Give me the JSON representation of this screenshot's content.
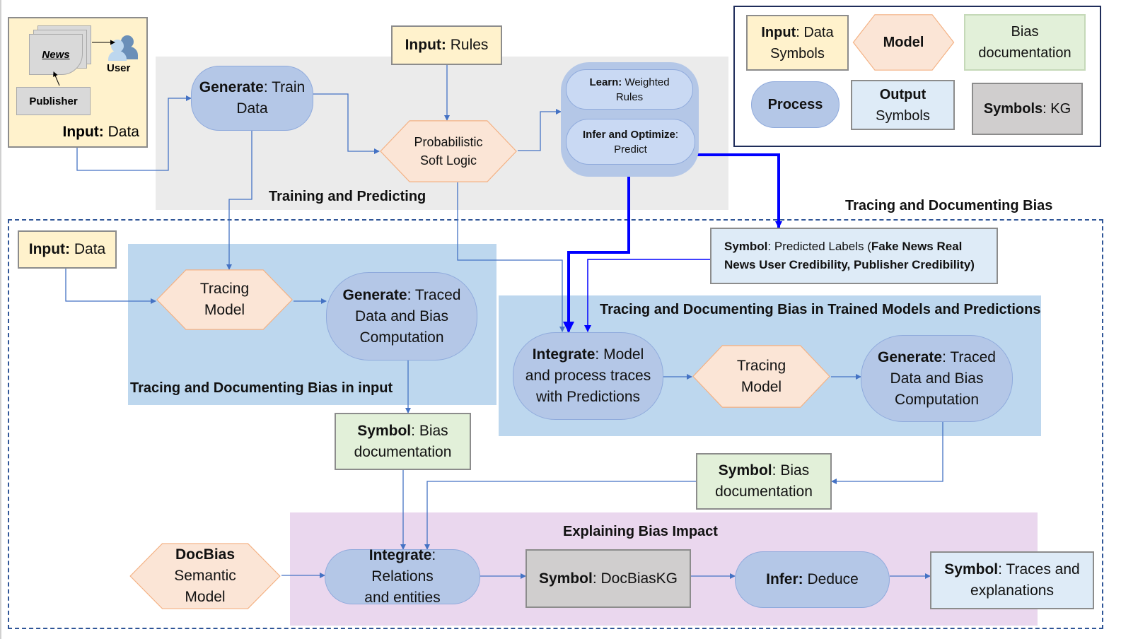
{
  "legend": {
    "input": {
      "bold": "Input",
      "rest": ": Data Symbols"
    },
    "model": "Model",
    "bias_doc": "Bias documentation",
    "process": "Process",
    "output": {
      "bold": "Output",
      "rest": "Symbols"
    },
    "kg": {
      "bold": "Symbols",
      "rest": ": KG"
    }
  },
  "input_data_box": {
    "news": "News",
    "user": "User",
    "publisher": "Publisher",
    "bold": "Input:",
    "rest": " Data"
  },
  "training": {
    "section_label": "Training and  Predicting",
    "input_rules": {
      "bold": "Input:",
      "rest": " Rules"
    },
    "generate_train": {
      "bold": "Generate",
      "rest": ": Train Data"
    },
    "psl": "Probabilistic Soft Logic",
    "learn": {
      "bold": "Learn:",
      "rest": " Weighted Rules"
    },
    "infer": {
      "bold": "Infer and Optimize",
      "rest": ": Predict"
    }
  },
  "tracing": {
    "section_label": "Tracing and  Documenting Bias",
    "input_data": {
      "bold": "Input:",
      "rest": " Data"
    },
    "input_section_label": "Tracing and Documenting Bias in input",
    "tracing_model": "Tracing Model",
    "generate_traced": {
      "bold": "Generate",
      "rest": ": Traced Data and Bias Computation"
    },
    "bias_doc_1": {
      "bold": "Symbol",
      "rest": ": Bias documentation"
    },
    "predicted_labels": {
      "bold": "Symbol",
      "rest": ": Predicted Labels (",
      "bold2": "Fake News Real News User Credibility, Publisher Credibility)"
    },
    "trained_section_label": "Tracing and Documenting Bias in Trained Models and  Predictions",
    "integrate": {
      "bold": "Integrate",
      "rest": ": Model and process traces with Predictions"
    },
    "tracing_model_2": "Tracing Model",
    "generate_traced_2": {
      "bold": "Generate",
      "rest": ": Traced Data and Bias Computation"
    },
    "bias_doc_2": {
      "bold": "Symbol",
      "rest": ": Bias documentation"
    }
  },
  "explaining": {
    "section_label": "Explaining Bias Impact",
    "docbias": {
      "bold": "DocBias",
      "rest": "Semantic Model"
    },
    "integrate": {
      "bold": "Integrate",
      "rest": ": Relations and entities"
    },
    "kg": {
      "bold": "Symbol",
      "rest": ": DocBiasKG"
    },
    "infer": {
      "bold": "Infer:",
      "rest": " Deduce"
    },
    "traces": {
      "bold": "Symbol",
      "rest": ": Traces and explanations"
    }
  },
  "colors": {
    "arrow": "#4472c4",
    "highlight_arrow": "#0000ff",
    "dashed_border": "#2f5597"
  }
}
